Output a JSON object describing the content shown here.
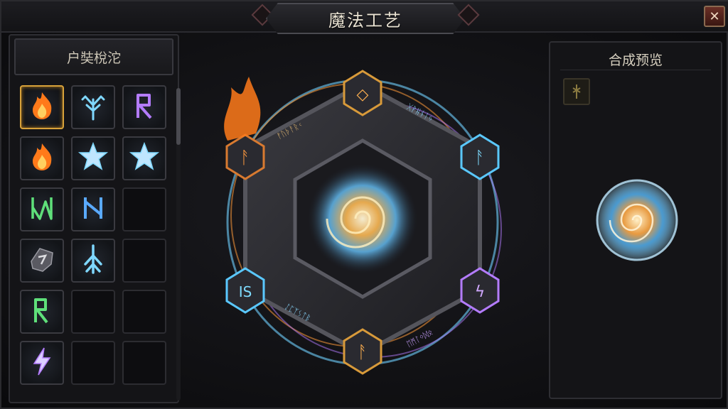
{
  "window": {
    "title": "魔法工艺",
    "close_label": "✕"
  },
  "left_panel": {
    "title": "户奘梲沱",
    "slots": [
      {
        "icon": "fire-icon",
        "selected": true
      },
      {
        "icon": "frost-branch-icon"
      },
      {
        "icon": "purple-rune-icon"
      },
      {
        "icon": "fire-icon"
      },
      {
        "icon": "ice-crystal-icon"
      },
      {
        "icon": "ice-crystal-icon"
      },
      {
        "icon": "green-rune-icon"
      },
      {
        "icon": "blue-rune-icon"
      },
      {
        "icon": "empty"
      },
      {
        "icon": "stone-rune-icon"
      },
      {
        "icon": "ice-shard-icon"
      },
      {
        "icon": "empty"
      },
      {
        "icon": "green-rune-r-icon"
      },
      {
        "icon": "empty"
      },
      {
        "icon": "empty"
      },
      {
        "icon": "lightning-icon"
      },
      {
        "icon": "empty"
      },
      {
        "icon": "empty"
      }
    ]
  },
  "right_panel": {
    "title": "合成预览",
    "orb_icon": "arcane-orb-icon"
  },
  "colors": {
    "fire": "#ff7a1a",
    "frost": "#7fd8ff",
    "arcane": "#b47cff",
    "nature": "#5fe07a",
    "gold": "#d8a23a"
  }
}
